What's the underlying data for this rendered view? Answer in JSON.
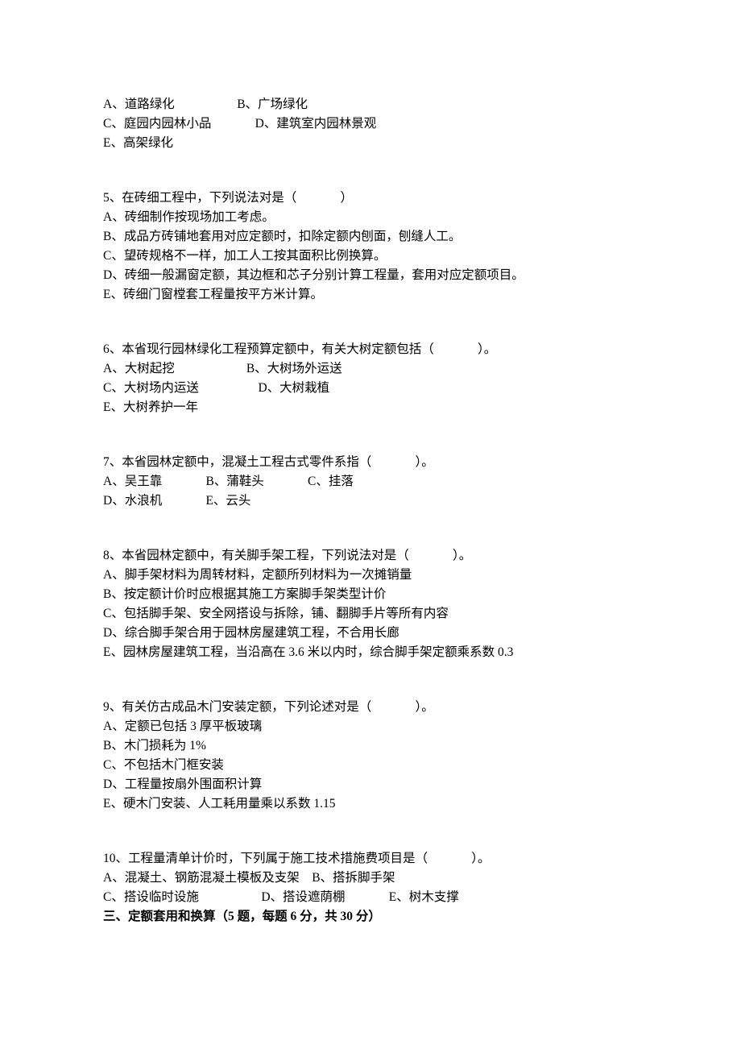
{
  "q_continued": {
    "lines": [
      "A、道路绿化                    B、广场绿化",
      "C、庭园内园林小品              D、建筑室内园林景观",
      "E、高架绿化"
    ]
  },
  "q5": {
    "stem": "5、在砖细工程中，下列说法对是（              ）",
    "options": [
      "A、砖细制作按现场加工考虑。",
      "B、成品方砖铺地套用对应定额时，扣除定额内刨面，刨缝人工。",
      "C、望砖规格不一样，加工人工按其面积比例换算。",
      "D、砖细一般漏窗定额，其边框和芯子分别计算工程量，套用对应定额项目。",
      "E、砖细门窗樘套工程量按平方米计算。"
    ]
  },
  "q6": {
    "stem": "6、本省现行园林绿化工程预算定额中，有关大树定额包括（              ）。",
    "lines": [
      "A、大树起挖                       B、大树场外运送",
      "C、大树场内运送                   D、大树栽植",
      "E、大树养护一年"
    ]
  },
  "q7": {
    "stem": "7、本省园林定额中，混凝土工程古式零件系指（              ）。",
    "lines": [
      "A、吴王靠              B、蒲鞋头              C、挂落",
      "D、水浪机              E、云头"
    ]
  },
  "q8": {
    "stem": "8、本省园林定额中，有关脚手架工程，下列说法对是（              ）。",
    "options": [
      "A、脚手架材料为周转材料，定额所列材料为一次摊销量",
      "B、按定额计价时应根据其施工方案脚手架类型计价",
      "C、包括脚手架、安全网搭设与拆除，铺、翻脚手片等所有内容",
      "D、综合脚手架合用于园林房屋建筑工程，不合用长廊",
      "E、园林房屋建筑工程，当沿高在 3.6 米以内时，综合脚手架定额乘系数 0.3"
    ]
  },
  "q9": {
    "stem": "9、有关仿古成品木门安装定额，下列论述对是（              ）。",
    "options": [
      "A、定额已包括 3 厚平板玻璃",
      "B、木门损耗为 1%",
      "C、不包括木门框安装",
      "D、工程量按扇外围面积计算",
      "E、硬木门安装、人工耗用量乘以系数 1.15"
    ]
  },
  "q10": {
    "stem": "10、工程量清单计价时，下列属于施工技术措施费项目是（              ）。",
    "lines": [
      "A、混凝土、钢筋混凝土模板及支架    B、搭拆脚手架",
      "C、搭设临时设施                    D、搭设遮荫棚              E、树木支撑"
    ]
  },
  "section3_heading": "三、定额套用和换算（5 题，每题 6 分，共 30 分）"
}
